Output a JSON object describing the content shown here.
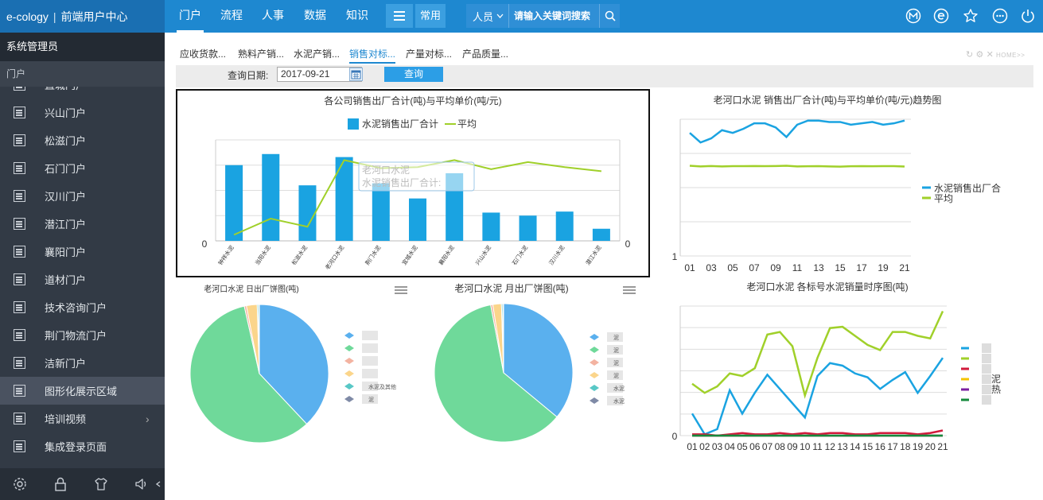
{
  "app": {
    "brand": "e-cology",
    "product": "前端用户中心"
  },
  "nav": {
    "items": [
      "门户",
      "流程",
      "人事",
      "数据",
      "知识"
    ],
    "common": "常用"
  },
  "search": {
    "scope": "人员",
    "placeholder": "请输入关键词搜索"
  },
  "topIcons": [
    "m-icon",
    "e-icon",
    "star-icon",
    "more-icon",
    "power-icon"
  ],
  "sidebar": {
    "user": "系统管理员",
    "section": "门户",
    "items": [
      {
        "label": "直城门户"
      },
      {
        "label": "兴山门户"
      },
      {
        "label": "松滋门户"
      },
      {
        "label": "石门门户"
      },
      {
        "label": "汉川门户"
      },
      {
        "label": "潜江门户"
      },
      {
        "label": "襄阳门户"
      },
      {
        "label": "道材门户"
      },
      {
        "label": "技术咨询门户"
      },
      {
        "label": "荆门物流门户"
      },
      {
        "label": "洁新门户"
      },
      {
        "label": "图形化展示区域"
      },
      {
        "label": "培训视频"
      },
      {
        "label": "集成登录页面"
      }
    ],
    "active_index": 11
  },
  "tabs": [
    "应收货款...",
    "熟料产销...",
    "水泥产销...",
    "销售对标...",
    "产量对标...",
    "产品质量..."
  ],
  "tabs_active": 3,
  "right_tools": "HOME>>",
  "query": {
    "label": "查询日期:",
    "date": "2017-09-21",
    "button": "查询"
  },
  "colors": {
    "blue": "#1aa3e1",
    "green": "#a0d02a",
    "nav": "#1e88d0"
  },
  "chart_data": [
    {
      "type": "bar",
      "title": "各公司销售出厂合计(吨)与平均单价(吨/元)",
      "legend": [
        "水泥销售出厂合计",
        "平均"
      ],
      "categories": [
        "钟祥水泥",
        "当阳水泥",
        "松滋水泥",
        "老河口水泥",
        "荆门水泥",
        "宜城水泥",
        "襄阳水泥",
        "兴山水泥",
        "石门水泥",
        "汉川水泥",
        "潜江水泥"
      ],
      "series": [
        {
          "name": "水泥销售出厂合计",
          "type": "bar",
          "values": [
            0.75,
            0.86,
            0.55,
            0.83,
            0.57,
            0.42,
            0.67,
            0.28,
            0.25,
            0.29,
            0.12
          ]
        },
        {
          "name": "平均",
          "type": "line",
          "values": [
            0.06,
            0.22,
            0.14,
            0.8,
            0.72,
            0.73,
            0.8,
            0.71,
            0.78,
            0.73,
            0.69
          ]
        }
      ],
      "ylim": [
        0,
        1
      ],
      "y_tick_label": "0",
      "y2_tick_label": "0",
      "tooltip": {
        "line1": "老河口水泥",
        "line2": "水泥销售出厂合计:"
      },
      "grid": true
    },
    {
      "type": "line",
      "title": "老河口水泥 销售出厂合计(吨)与平均单价(吨/元)趋势图",
      "categories": [
        "01",
        "02",
        "03",
        "04",
        "05",
        "06",
        "07",
        "08",
        "09",
        "10",
        "11",
        "12",
        "13",
        "14",
        "15",
        "16",
        "17",
        "18",
        "19",
        "20",
        "21"
      ],
      "x_tick_labels": [
        "01",
        "03",
        "05",
        "07",
        "09",
        "11",
        "13",
        "15",
        "17",
        "19",
        "21"
      ],
      "y_tick_label": "1",
      "legend": [
        "水泥销售出厂合",
        "平均"
      ],
      "series": [
        {
          "name": "水泥销售出厂合",
          "values": [
            0.9,
            0.83,
            0.86,
            0.92,
            0.9,
            0.93,
            0.97,
            0.97,
            0.94,
            0.87,
            0.96,
            0.99,
            0.99,
            0.98,
            0.98,
            0.96,
            0.97,
            0.98,
            0.96,
            0.97,
            0.99
          ]
        },
        {
          "name": "平均",
          "values": [
            0.66,
            0.655,
            0.658,
            0.655,
            0.657,
            0.657,
            0.658,
            0.657,
            0.658,
            0.66,
            0.655,
            0.656,
            0.657,
            0.655,
            0.653,
            0.656,
            0.657,
            0.656,
            0.657,
            0.657,
            0.654
          ]
        }
      ],
      "grid": true
    },
    {
      "type": "pie",
      "title": "老河口水泥 日出厂饼图(吨)",
      "slices": [
        {
          "label": "",
          "value": 38,
          "color": "#5ab0ee"
        },
        {
          "label": "",
          "value": 58.5,
          "color": "#6fd99a"
        },
        {
          "label": "",
          "value": 0.5,
          "color": "#f3b3a1"
        },
        {
          "label": "",
          "value": 2.5,
          "color": "#fbd58b"
        },
        {
          "label": "水泥及其他",
          "value": 0.3,
          "color": "#58c8c6"
        },
        {
          "label": "泥",
          "value": 0.2,
          "color": "#7f8aa6"
        }
      ]
    },
    {
      "type": "pie",
      "title": "老河口水泥 月出厂饼图(吨)",
      "slices": [
        {
          "label": "泥",
          "value": 36,
          "color": "#5ab0ee"
        },
        {
          "label": "泥",
          "value": 61,
          "color": "#6fd99a"
        },
        {
          "label": "泥",
          "value": 0.5,
          "color": "#f3b3a1"
        },
        {
          "label": "泥",
          "value": 2,
          "color": "#fbd58b"
        },
        {
          "label": "水泥",
          "value": 0.3,
          "color": "#58c8c6"
        },
        {
          "label": "水泥",
          "value": 0.2,
          "color": "#7f8aa6"
        }
      ]
    },
    {
      "type": "line",
      "title": "老河口水泥 各标号水泥销量时序图(吨)",
      "categories": [
        "01",
        "02",
        "03",
        "04",
        "05",
        "06",
        "07",
        "08",
        "09",
        "10",
        "11",
        "12",
        "13",
        "14",
        "15",
        "16",
        "17",
        "18",
        "19",
        "20",
        "21"
      ],
      "y_tick_label": "0",
      "legend": [
        "",
        "",
        "",
        "泥",
        "热",
        ""
      ],
      "series": [
        {
          "name": "",
          "color": "#1aa3e1",
          "values": [
            0.17,
            0.01,
            0.05,
            0.35,
            0.17,
            0.33,
            0.47,
            0.36,
            0.25,
            0.14,
            0.46,
            0.56,
            0.54,
            0.48,
            0.45,
            0.36,
            0.43,
            0.49,
            0.33,
            0.46,
            0.6
          ]
        },
        {
          "name": "",
          "color": "#a0d02a",
          "values": [
            0.4,
            0.33,
            0.38,
            0.48,
            0.46,
            0.52,
            0.78,
            0.8,
            0.69,
            0.31,
            0.6,
            0.83,
            0.84,
            0.77,
            0.7,
            0.66,
            0.8,
            0.8,
            0.77,
            0.75,
            0.96
          ]
        },
        {
          "name": "",
          "color": "#d11a3b",
          "values": [
            0.01,
            0.01,
            0.0,
            0.01,
            0.02,
            0.01,
            0.01,
            0.02,
            0.01,
            0.02,
            0.01,
            0.02,
            0.02,
            0.01,
            0.01,
            0.02,
            0.02,
            0.02,
            0.01,
            0.02,
            0.04
          ]
        },
        {
          "name": "泥",
          "color": "#f5c400",
          "values": [
            0,
            0,
            0,
            0,
            0,
            0,
            0,
            0,
            0,
            0,
            0,
            0,
            0,
            0,
            0,
            0,
            0,
            0,
            0,
            0,
            0
          ]
        },
        {
          "name": "热",
          "color": "#7b1fa2",
          "values": [
            0,
            0,
            0,
            0,
            0,
            0,
            0,
            0,
            0,
            0,
            0,
            0,
            0,
            0,
            0,
            0,
            0,
            0,
            0,
            0,
            0
          ]
        },
        {
          "name": "",
          "color": "#168a3c",
          "values": [
            0,
            0,
            0,
            0,
            0,
            0,
            0,
            0,
            0,
            0,
            0,
            0,
            0,
            0,
            0,
            0,
            0,
            0,
            0,
            0,
            0
          ]
        }
      ],
      "grid": true
    }
  ]
}
